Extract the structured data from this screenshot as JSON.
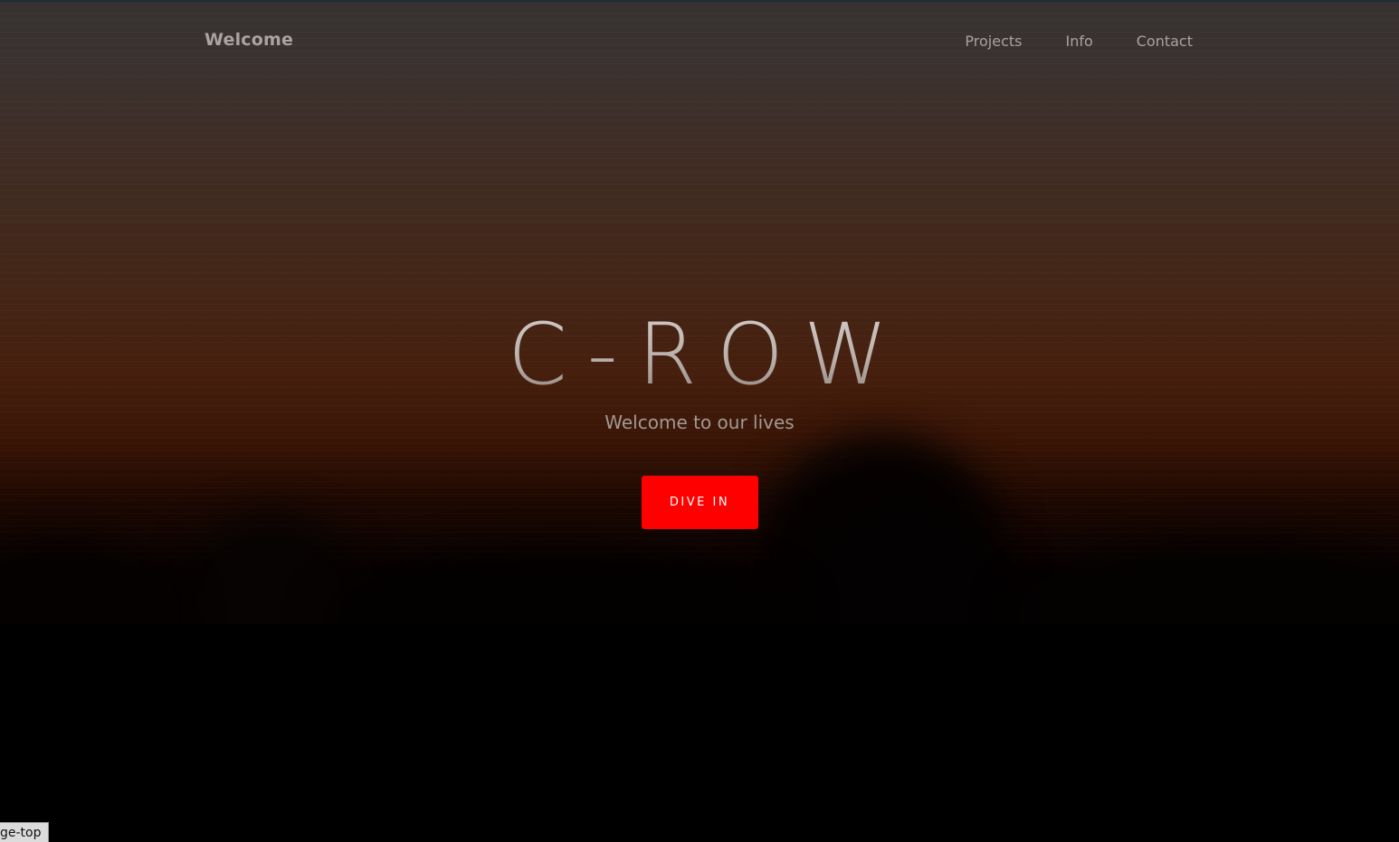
{
  "navbar": {
    "brand": "Welcome",
    "links": [
      {
        "label": "Projects"
      },
      {
        "label": "Info"
      },
      {
        "label": "Contact"
      }
    ]
  },
  "hero": {
    "title": "C-ROW",
    "subtitle": "Welcome to our lives",
    "cta_label": "DIVE IN"
  },
  "status_tooltip": {
    "text": "ge-top"
  },
  "colors": {
    "accent": "#ff0000",
    "nav_text": "#a7a29f",
    "sky_top": "#363130",
    "sky_mid": "#461f0e",
    "ground": "#000000"
  }
}
